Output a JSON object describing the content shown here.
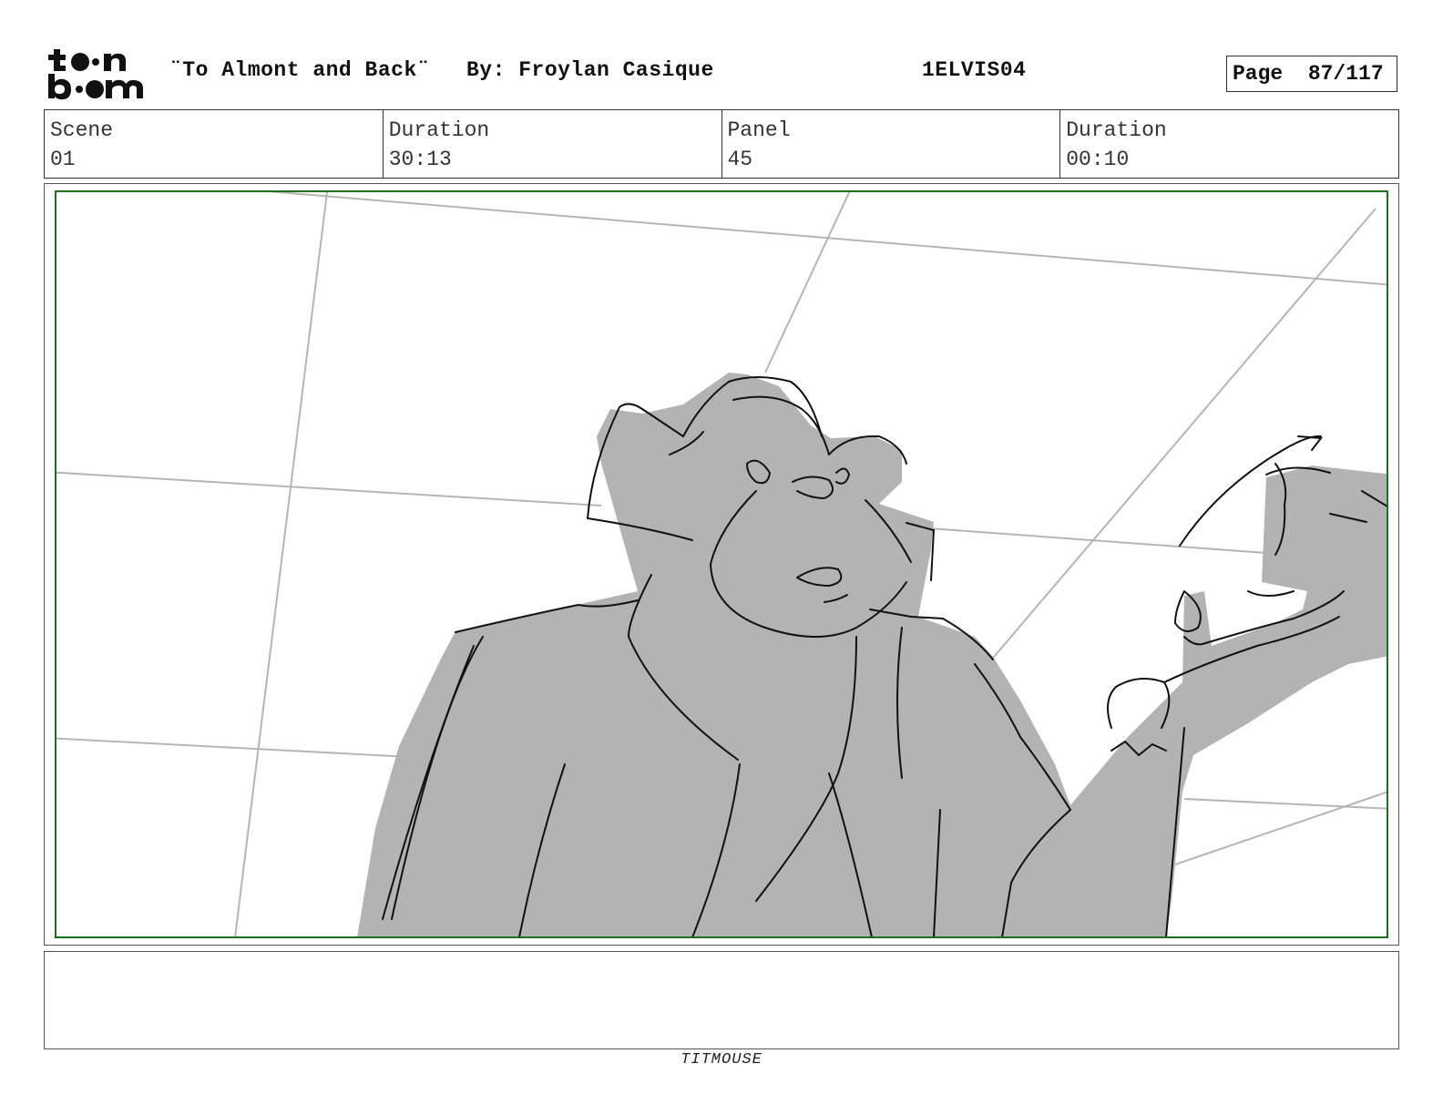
{
  "header": {
    "title": "¨To Almont and Back¨",
    "author": "By: Froylan Casique",
    "episode_code": "1ELVIS04",
    "page": "Page  87/117",
    "logo_text": "toonboom"
  },
  "info": {
    "scene_label": "Scene",
    "scene_value": "01",
    "duration_label": "Duration",
    "duration_value": "30:13",
    "panel_label": "Panel",
    "panel_value": "45",
    "panel_duration_label": "Duration",
    "panel_duration_value": "00:10"
  },
  "panel": {
    "description": "",
    "frame_color": "#1f6e24",
    "fill_color": "#b3b3b3"
  },
  "notes": {
    "text": ""
  },
  "footer": {
    "studio": "TITMOUSE"
  }
}
